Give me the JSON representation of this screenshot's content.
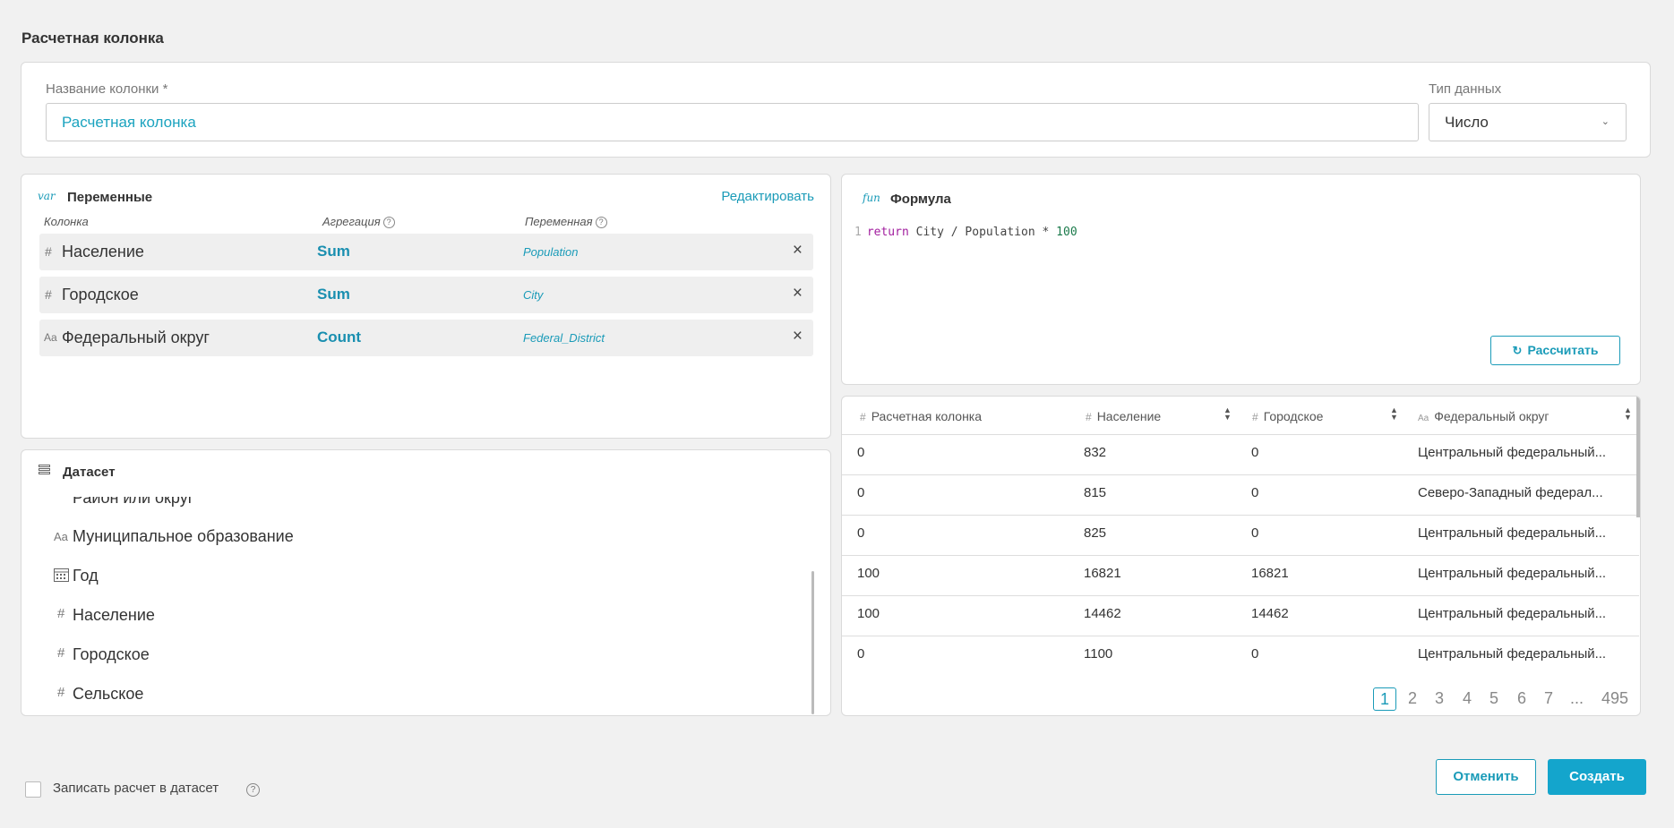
{
  "page_title": "Расчетная колонка",
  "column_name": {
    "label": "Название колонки *",
    "value": "Расчетная колонка"
  },
  "data_type": {
    "label": "Тип данных",
    "value": "Число"
  },
  "variables": {
    "title": "Переменные",
    "icon_text": "var",
    "edit_label": "Редактировать",
    "headers": {
      "column": "Колонка",
      "aggregation": "Агрегация",
      "variable": "Переменная"
    },
    "rows": [
      {
        "type": "#",
        "name": "Население",
        "aggregation": "Sum",
        "variable": "Population"
      },
      {
        "type": "#",
        "name": "Городское",
        "aggregation": "Sum",
        "variable": "City"
      },
      {
        "type": "Aa",
        "name": "Федеральный округ",
        "aggregation": "Count",
        "variable": "Federal_District"
      }
    ]
  },
  "formula": {
    "title": "Формула",
    "icon_text": "fun",
    "line_number": "1",
    "keyword": "return",
    "expression": " City / Population * ",
    "number": "100",
    "calc_label": "Рассчитать"
  },
  "dataset": {
    "title": "Датасет",
    "partial_item": "Район или округ",
    "items": [
      {
        "type": "Aa",
        "name": "Муниципальное образование"
      },
      {
        "type": "calendar",
        "name": "Год"
      },
      {
        "type": "#",
        "name": "Население"
      },
      {
        "type": "#",
        "name": "Городское"
      },
      {
        "type": "#",
        "name": "Сельское"
      }
    ]
  },
  "table": {
    "headers": [
      {
        "type": "#",
        "label": "Расчетная колонка"
      },
      {
        "type": "#",
        "label": "Население"
      },
      {
        "type": "#",
        "label": "Городское"
      },
      {
        "type": "Aa",
        "label": "Федеральный округ"
      }
    ],
    "rows": [
      [
        "0",
        "832",
        "0",
        "Центральный федеральный..."
      ],
      [
        "0",
        "815",
        "0",
        "Северо-Западный федерал..."
      ],
      [
        "0",
        "825",
        "0",
        "Центральный федеральный..."
      ],
      [
        "100",
        "16821",
        "16821",
        "Центральный федеральный..."
      ],
      [
        "100",
        "14462",
        "14462",
        "Центральный федеральный..."
      ],
      [
        "0",
        "1100",
        "0",
        "Центральный федеральный..."
      ]
    ],
    "pages": [
      "1",
      "2",
      "3",
      "4",
      "5",
      "6",
      "7",
      "...",
      "495"
    ],
    "active_page": "1"
  },
  "footer": {
    "write_label": "Записать расчет в датасет",
    "cancel_label": "Отменить",
    "create_label": "Создать"
  },
  "colors": {
    "accent": "#1a9bb8",
    "primary_button": "#14a5cc",
    "background": "#f1f1f1"
  }
}
